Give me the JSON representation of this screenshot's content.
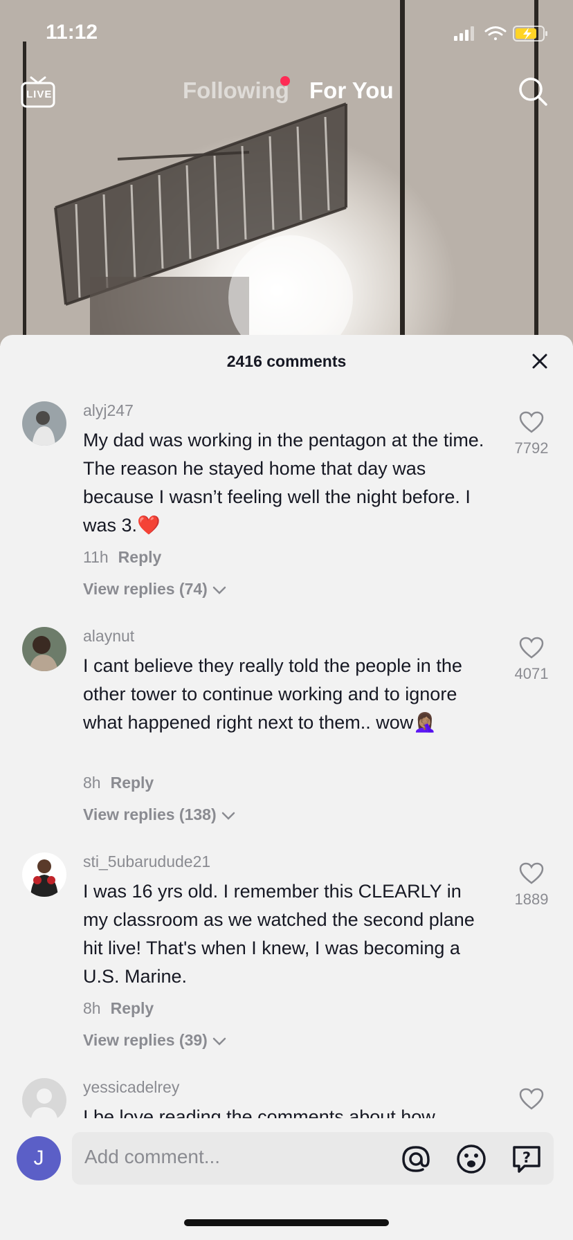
{
  "status_bar": {
    "time": "11:12"
  },
  "top_nav": {
    "live_label": "LIVE",
    "tabs": [
      {
        "label": "Following",
        "active": false,
        "has_dot": true
      },
      {
        "label": "For You",
        "active": true
      }
    ]
  },
  "comments_sheet": {
    "title": "2416 comments",
    "comments": [
      {
        "username": "alyj247",
        "text": "My dad was working in the pentagon at the time. The reason he stayed home that day was because I wasn’t feeling well the night before. I was 3.❤️",
        "time": "11h",
        "reply_label": "Reply",
        "view_replies": "View replies (74)",
        "likes": "7792"
      },
      {
        "username": "alaynut",
        "text": "I cant believe they really told the people in the other tower to continue working and to ignore what happened right next to them.. wow🤦🏽‍♀️",
        "time": "8h",
        "reply_label": "Reply",
        "view_replies": "View replies (138)",
        "likes": "4071"
      },
      {
        "username": "sti_5ubarudude21",
        "text": "I was 16 yrs old. I remember this CLEARLY in my classroom as we watched the second plane hit live! That's when I knew, I was becoming a U.S. Marine.",
        "time": "8h",
        "reply_label": "Reply",
        "view_replies": "View replies (39)",
        "likes": "1889"
      },
      {
        "username": "yessicadelrey",
        "text": "I be love reading the comments about how"
      }
    ]
  },
  "composer": {
    "avatar_letter": "J",
    "placeholder": "Add comment..."
  },
  "colors": {
    "accent_dot": "#fe2c55",
    "avatar_bg": "#5b5fc7"
  }
}
